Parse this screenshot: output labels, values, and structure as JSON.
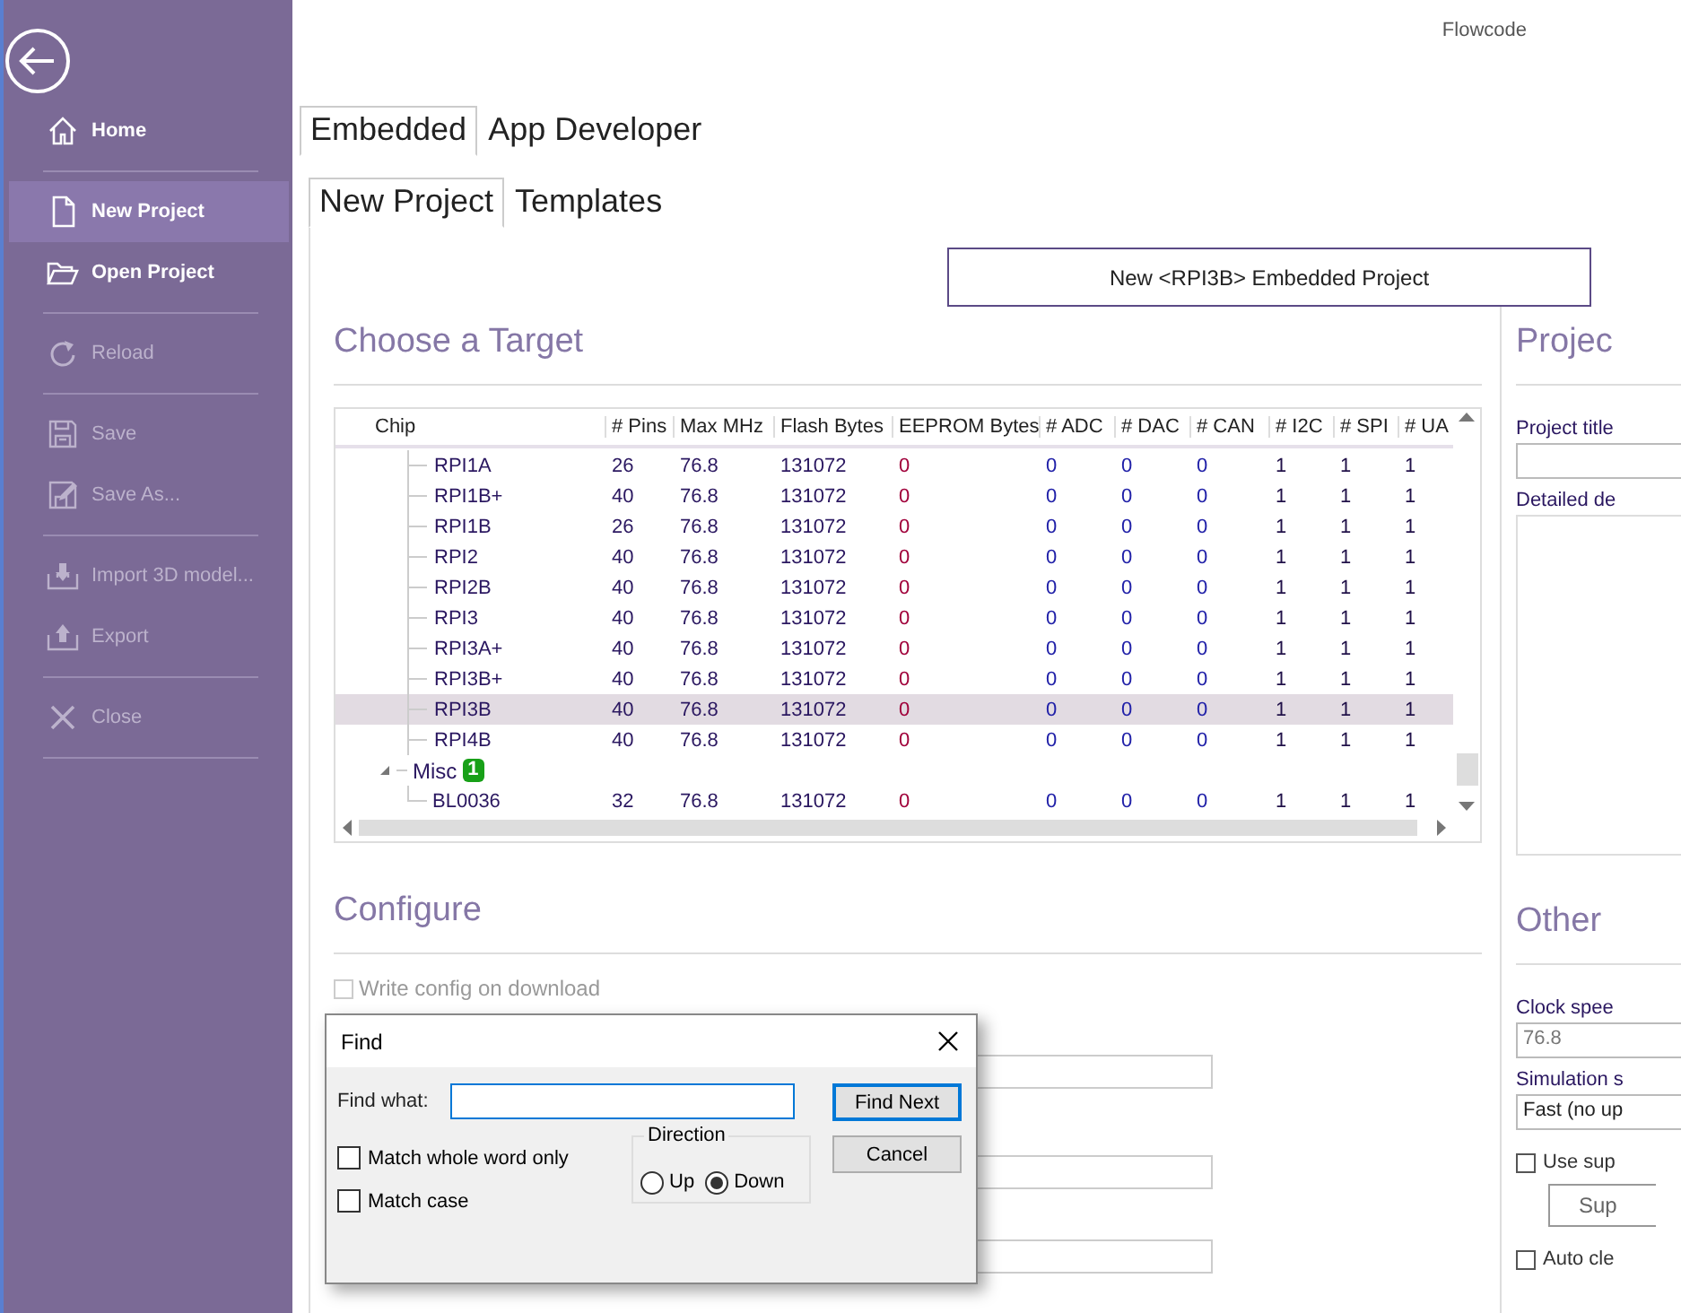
{
  "app_title": "Flowcode",
  "sidebar": {
    "groups": [
      [
        {
          "kind": "home",
          "label": "Home",
          "selected": false,
          "disabled": false
        }
      ],
      [
        {
          "kind": "file",
          "label": "New Project",
          "selected": true,
          "disabled": false
        },
        {
          "kind": "folder",
          "label": "Open Project",
          "selected": false,
          "disabled": false
        }
      ],
      [
        {
          "kind": "reload",
          "label": "Reload",
          "selected": false,
          "disabled": true
        }
      ],
      [
        {
          "kind": "save",
          "label": "Save",
          "selected": false,
          "disabled": true
        },
        {
          "kind": "save-as",
          "label": "Save As...",
          "selected": false,
          "disabled": true
        }
      ],
      [
        {
          "kind": "import",
          "label": "Import 3D model...",
          "selected": false,
          "disabled": true
        },
        {
          "kind": "export",
          "label": "Export",
          "selected": false,
          "disabled": true
        }
      ],
      [
        {
          "kind": "close",
          "label": "Close",
          "selected": false,
          "disabled": true
        }
      ]
    ]
  },
  "tabs": [
    {
      "label": "Embedded",
      "selected": true
    },
    {
      "label": "App Developer",
      "selected": false
    }
  ],
  "subtabs": [
    {
      "label": "New Project",
      "selected": true
    },
    {
      "label": "Templates",
      "selected": false
    }
  ],
  "create_button": "New <RPI3B> Embedded Project",
  "target_section": {
    "heading": "Choose a Target",
    "columns": [
      "Chip",
      "# Pins",
      "Max MHz",
      "Flash Bytes",
      "EEPROM Bytes",
      "# ADC",
      "# DAC",
      "# CAN",
      "# I2C",
      "# SPI",
      "# UA"
    ],
    "items": [
      {
        "kind": "chip",
        "name": "RPI1A",
        "values": [
          "26",
          "76.8",
          "131072",
          "0",
          "0",
          "0",
          "0",
          "1",
          "1",
          "1"
        ],
        "selected": false
      },
      {
        "kind": "chip",
        "name": "RPI1B+",
        "values": [
          "40",
          "76.8",
          "131072",
          "0",
          "0",
          "0",
          "0",
          "1",
          "1",
          "1"
        ],
        "selected": false
      },
      {
        "kind": "chip",
        "name": "RPI1B",
        "values": [
          "26",
          "76.8",
          "131072",
          "0",
          "0",
          "0",
          "0",
          "1",
          "1",
          "1"
        ],
        "selected": false
      },
      {
        "kind": "chip",
        "name": "RPI2",
        "values": [
          "40",
          "76.8",
          "131072",
          "0",
          "0",
          "0",
          "0",
          "1",
          "1",
          "1"
        ],
        "selected": false
      },
      {
        "kind": "chip",
        "name": "RPI2B",
        "values": [
          "40",
          "76.8",
          "131072",
          "0",
          "0",
          "0",
          "0",
          "1",
          "1",
          "1"
        ],
        "selected": false
      },
      {
        "kind": "chip",
        "name": "RPI3",
        "values": [
          "40",
          "76.8",
          "131072",
          "0",
          "0",
          "0",
          "0",
          "1",
          "1",
          "1"
        ],
        "selected": false
      },
      {
        "kind": "chip",
        "name": "RPI3A+",
        "values": [
          "40",
          "76.8",
          "131072",
          "0",
          "0",
          "0",
          "0",
          "1",
          "1",
          "1"
        ],
        "selected": false
      },
      {
        "kind": "chip",
        "name": "RPI3B+",
        "values": [
          "40",
          "76.8",
          "131072",
          "0",
          "0",
          "0",
          "0",
          "1",
          "1",
          "1"
        ],
        "selected": false
      },
      {
        "kind": "chip",
        "name": "RPI3B",
        "values": [
          "40",
          "76.8",
          "131072",
          "0",
          "0",
          "0",
          "0",
          "1",
          "1",
          "1"
        ],
        "selected": true
      },
      {
        "kind": "chip",
        "name": "RPI4B",
        "values": [
          "40",
          "76.8",
          "131072",
          "0",
          "0",
          "0",
          "0",
          "1",
          "1",
          "1"
        ],
        "selected": false
      },
      {
        "kind": "group",
        "name": "Misc",
        "badge": "1",
        "expanded": true,
        "children": [
          {
            "kind": "chip",
            "name": "BL0036",
            "values": [
              "32",
              "76.8",
              "131072",
              "0",
              "0",
              "0",
              "0",
              "1",
              "1",
              "1"
            ],
            "selected": false
          }
        ]
      }
    ]
  },
  "project_section": {
    "heading": "Projec",
    "title_label": "Project title",
    "description_label": "Detailed de"
  },
  "configure_section": {
    "heading": "Configure",
    "options": [
      {
        "label": "Write config on download",
        "checked": false,
        "disabled": true
      }
    ]
  },
  "other_section": {
    "heading": "Other",
    "clock_label": "Clock spee",
    "clock_value": "76.8",
    "sim_label": "Simulation s",
    "sim_value": "Fast (no up",
    "controls": [
      {
        "kind": "checkbox",
        "label": "Use sup",
        "checked": false
      },
      {
        "kind": "button",
        "label": "Sup"
      },
      {
        "kind": "checkbox",
        "label": "Auto cle",
        "checked": false
      }
    ]
  },
  "find_dialog": {
    "title": "Find",
    "find_label": "Find what:",
    "options": [
      {
        "label": "Match whole word only",
        "checked": false
      },
      {
        "label": "Match case",
        "checked": false
      }
    ],
    "direction": {
      "label": "Direction",
      "choices": [
        {
          "label": "Up",
          "selected": false
        },
        {
          "label": "Down",
          "selected": true
        }
      ]
    },
    "buttons": [
      {
        "label": "Find Next",
        "default": true
      },
      {
        "label": "Cancel",
        "default": false
      }
    ]
  }
}
